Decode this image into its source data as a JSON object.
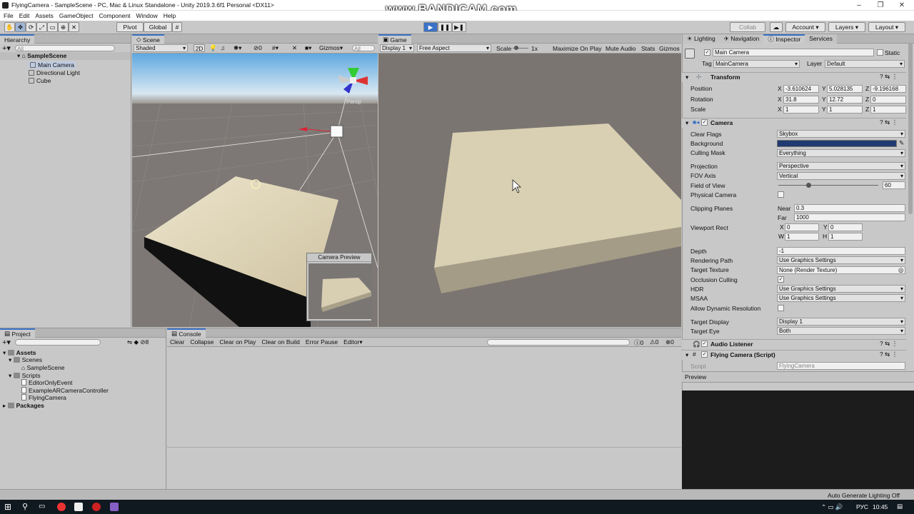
{
  "window": {
    "title": "FlyingCamera - SampleScene - PC, Mac & Linux Standalone - Unity 2019.3.6f1 Personal <DX11>"
  },
  "watermark": "www.BANDICAM.com",
  "menu": [
    "File",
    "Edit",
    "Assets",
    "GameObject",
    "Component",
    "Window",
    "Help"
  ],
  "toolbar": {
    "pivot": "Pivot",
    "global": "Global",
    "collab": "Collab",
    "account": "Account",
    "layers": "Layers",
    "layout": "Layout"
  },
  "hierarchy": {
    "tab": "Hierarchy",
    "search_placeholder": "All",
    "scene": "SampleScene",
    "items": [
      "Main Camera",
      "Directional Light",
      "Cube"
    ]
  },
  "scene": {
    "tab": "Scene",
    "shading": "Shaded",
    "mode2d": "2D",
    "fx_count": "0",
    "gizmos": "Gizmos",
    "search_placeholder": "All",
    "persp": "Persp",
    "camera_preview": "Camera Preview"
  },
  "game": {
    "tab": "Game",
    "display": "Display 1",
    "aspect": "Free Aspect",
    "scale_label": "Scale",
    "scale_value": "1x",
    "buttons": [
      "Maximize On Play",
      "Mute Audio",
      "Stats",
      "Gizmos"
    ]
  },
  "inspector": {
    "tabs": [
      "Lighting",
      "Navigation",
      "Inspector",
      "Services"
    ],
    "object_name": "Main Camera",
    "static_label": "Static",
    "tag_label": "Tag",
    "tag_value": "MainCamera",
    "layer_label": "Layer",
    "layer_value": "Default",
    "transform": {
      "title": "Transform",
      "position": {
        "label": "Position",
        "x": "-3.610624",
        "y": "5.028135",
        "z": "-9.196168"
      },
      "rotation": {
        "label": "Rotation",
        "x": "31.8",
        "y": "12.72",
        "z": "0"
      },
      "scale": {
        "label": "Scale",
        "x": "1",
        "y": "1",
        "z": "1"
      }
    },
    "camera": {
      "title": "Camera",
      "clear_flags_label": "Clear Flags",
      "clear_flags": "Skybox",
      "background_label": "Background",
      "background_color": "#1f3a70",
      "culling_mask_label": "Culling Mask",
      "culling_mask": "Everything",
      "projection_label": "Projection",
      "projection": "Perspective",
      "fov_axis_label": "FOV Axis",
      "fov_axis": "Vertical",
      "fov_label": "Field of View",
      "fov": "60",
      "fov_fraction": 0.3,
      "physical_label": "Physical Camera",
      "clipping_label": "Clipping Planes",
      "near_label": "Near",
      "near": "0.3",
      "far_label": "Far",
      "far": "1000",
      "viewport_label": "Viewport Rect",
      "vx": "0",
      "vy": "0",
      "vw": "1",
      "vh": "1",
      "depth_label": "Depth",
      "depth": "-1",
      "rendering_path_label": "Rendering Path",
      "rendering_path": "Use Graphics Settings",
      "target_texture_label": "Target Texture",
      "target_texture": "None (Render Texture)",
      "occlusion_label": "Occlusion Culling",
      "hdr_label": "HDR",
      "hdr": "Use Graphics Settings",
      "msaa_label": "MSAA",
      "msaa": "Use Graphics Settings",
      "dyn_res_label": "Allow Dynamic Resolution",
      "target_display_label": "Target Display",
      "target_display": "Display 1",
      "target_eye_label": "Target Eye",
      "target_eye": "Both"
    },
    "audio_listener": "Audio Listener",
    "flying_camera": "Flying Camera (Script)",
    "script_label": "Script",
    "script_value": "FlyingCamera",
    "preview": "Preview"
  },
  "project": {
    "tab": "Project",
    "count": "8",
    "assets": "Assets",
    "scenes": "Scenes",
    "sample_scene": "SampleScene",
    "scripts": "Scripts",
    "script_items": [
      "EditorOnlyEvent",
      "ExampleARCameraController",
      "FlyingCamera"
    ],
    "packages": "Packages"
  },
  "console": {
    "tab": "Console",
    "buttons": [
      "Clear",
      "Collapse",
      "Clear on Play",
      "Clear on Build",
      "Error Pause",
      "Editor"
    ],
    "counts": [
      "0",
      "0",
      "0"
    ]
  },
  "statusbar": "Auto Generate Lighting Off",
  "taskbar": {
    "lang": "РУС",
    "time": "10:45"
  }
}
